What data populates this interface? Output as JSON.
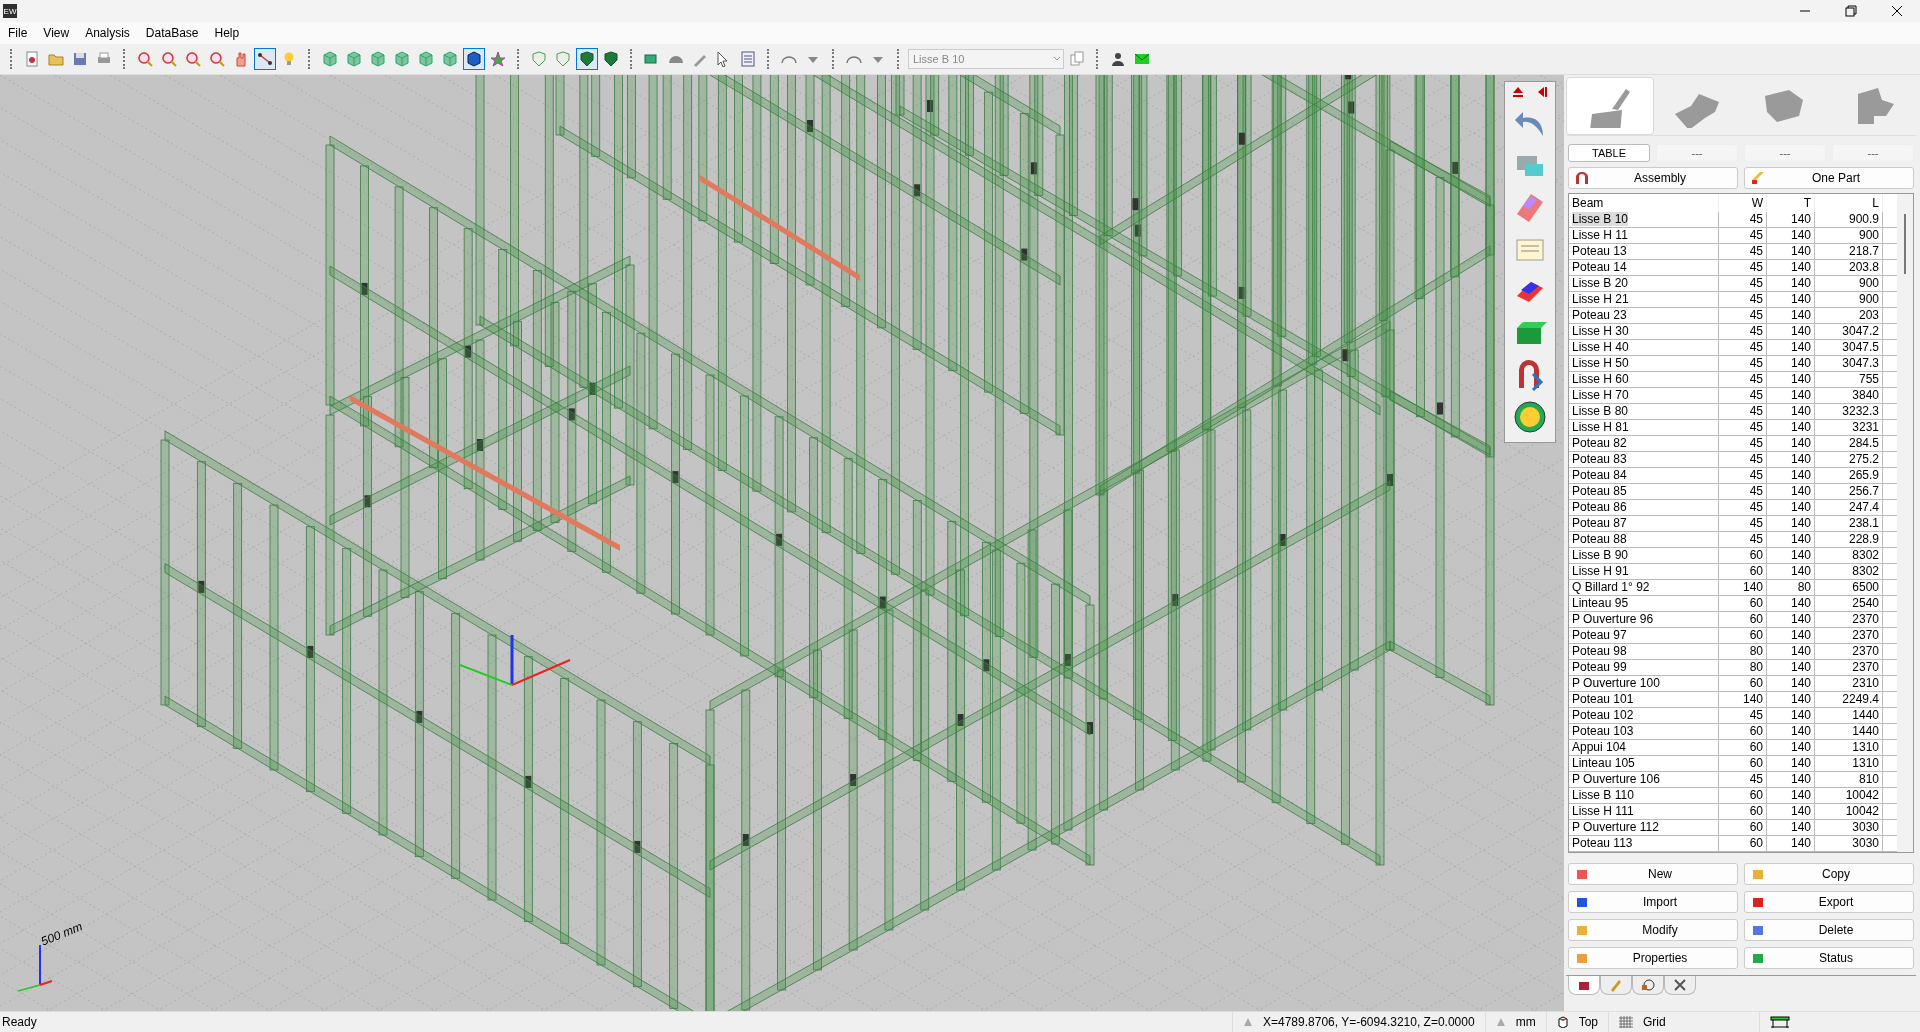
{
  "window": {
    "app_icon_text": "EW"
  },
  "menu": [
    "File",
    "View",
    "Analysis",
    "DataBase",
    "Help"
  ],
  "toolbar": {
    "groups": [
      {
        "buttons": [
          {
            "selected": false
          },
          {
            "selected": false
          },
          {
            "selected": false
          },
          {
            "selected": false
          }
        ]
      },
      {
        "buttons": [
          {
            "selected": false
          },
          {
            "selected": false
          },
          {
            "selected": false
          },
          {
            "selected": false
          },
          {
            "selected": false
          },
          {
            "selected": true
          },
          {
            "selected": false
          }
        ]
      },
      {
        "buttons": [
          {
            "selected": false
          },
          {
            "selected": false
          },
          {
            "selected": false
          },
          {
            "selected": false
          },
          {
            "selected": false
          },
          {
            "selected": false
          },
          {
            "selected": true
          },
          {
            "selected": false
          }
        ]
      },
      {
        "buttons": [
          {
            "selected": false
          },
          {
            "selected": false
          },
          {
            "selected": true
          },
          {
            "selected": false
          }
        ]
      },
      {
        "buttons": [
          {
            "selected": false
          },
          {
            "selected": false
          },
          {
            "selected": false
          },
          {
            "selected": false
          },
          {
            "selected": false
          }
        ]
      },
      {
        "buttons": [
          {
            "selected": false
          },
          {
            "selected": false
          }
        ]
      },
      {
        "buttons": [
          {
            "selected": false
          },
          {
            "selected": false
          }
        ]
      }
    ],
    "combo": {
      "value": "Lisse B 10",
      "disabled": true
    }
  },
  "viewport": {
    "scale_label": "500 mm"
  },
  "panel": {
    "icon_tabs": [
      {
        "selected": true
      },
      {
        "selected": false
      },
      {
        "selected": false
      },
      {
        "selected": false
      }
    ],
    "sub_tabs": [
      {
        "label": "TABLE",
        "selected": true
      },
      {
        "label": "---",
        "selected": false
      },
      {
        "label": "---",
        "selected": false
      },
      {
        "label": "---",
        "selected": false
      }
    ],
    "mode_buttons": [
      "Assembly",
      "One Part"
    ],
    "table": {
      "columns": [
        "Beam",
        "W",
        "T",
        "L"
      ],
      "rows": [
        {
          "beam": "Lisse B 10",
          "w": "45",
          "t": "140",
          "l": "900.9",
          "selected": true
        },
        {
          "beam": "Lisse H 11",
          "w": "45",
          "t": "140",
          "l": "900",
          "selected": false
        },
        {
          "beam": "Poteau 13",
          "w": "45",
          "t": "140",
          "l": "218.7",
          "selected": false
        },
        {
          "beam": "Poteau 14",
          "w": "45",
          "t": "140",
          "l": "203.8",
          "selected": false
        },
        {
          "beam": "Lisse B 20",
          "w": "45",
          "t": "140",
          "l": "900",
          "selected": false
        },
        {
          "beam": "Lisse H 21",
          "w": "45",
          "t": "140",
          "l": "900",
          "selected": false
        },
        {
          "beam": "Poteau 23",
          "w": "45",
          "t": "140",
          "l": "203",
          "selected": false
        },
        {
          "beam": "Lisse H 30",
          "w": "45",
          "t": "140",
          "l": "3047.2",
          "selected": false
        },
        {
          "beam": "Lisse H 40",
          "w": "45",
          "t": "140",
          "l": "3047.5",
          "selected": false
        },
        {
          "beam": "Lisse H 50",
          "w": "45",
          "t": "140",
          "l": "3047.3",
          "selected": false
        },
        {
          "beam": "Lisse H 60",
          "w": "45",
          "t": "140",
          "l": "755",
          "selected": false
        },
        {
          "beam": "Lisse H 70",
          "w": "45",
          "t": "140",
          "l": "3840",
          "selected": false
        },
        {
          "beam": "Lisse B 80",
          "w": "45",
          "t": "140",
          "l": "3232.3",
          "selected": false
        },
        {
          "beam": "Lisse H 81",
          "w": "45",
          "t": "140",
          "l": "3231",
          "selected": false
        },
        {
          "beam": "Poteau 82",
          "w": "45",
          "t": "140",
          "l": "284.5",
          "selected": false
        },
        {
          "beam": "Poteau 83",
          "w": "45",
          "t": "140",
          "l": "275.2",
          "selected": false
        },
        {
          "beam": "Poteau 84",
          "w": "45",
          "t": "140",
          "l": "265.9",
          "selected": false
        },
        {
          "beam": "Poteau 85",
          "w": "45",
          "t": "140",
          "l": "256.7",
          "selected": false
        },
        {
          "beam": "Poteau 86",
          "w": "45",
          "t": "140",
          "l": "247.4",
          "selected": false
        },
        {
          "beam": "Poteau 87",
          "w": "45",
          "t": "140",
          "l": "238.1",
          "selected": false
        },
        {
          "beam": "Poteau 88",
          "w": "45",
          "t": "140",
          "l": "228.9",
          "selected": false
        },
        {
          "beam": "Lisse B 90",
          "w": "60",
          "t": "140",
          "l": "8302",
          "selected": false
        },
        {
          "beam": "Lisse H 91",
          "w": "60",
          "t": "140",
          "l": "8302",
          "selected": false
        },
        {
          "beam": "Q Billard 1° 92",
          "w": "140",
          "t": "80",
          "l": "6500",
          "selected": false
        },
        {
          "beam": "Linteau 95",
          "w": "60",
          "t": "140",
          "l": "2540",
          "selected": false
        },
        {
          "beam": "P Ouverture 96",
          "w": "60",
          "t": "140",
          "l": "2370",
          "selected": false
        },
        {
          "beam": "Poteau 97",
          "w": "60",
          "t": "140",
          "l": "2370",
          "selected": false
        },
        {
          "beam": "Poteau 98",
          "w": "80",
          "t": "140",
          "l": "2370",
          "selected": false
        },
        {
          "beam": "Poteau 99",
          "w": "80",
          "t": "140",
          "l": "2370",
          "selected": false
        },
        {
          "beam": "P Ouverture 100",
          "w": "60",
          "t": "140",
          "l": "2310",
          "selected": false
        },
        {
          "beam": "Poteau 101",
          "w": "140",
          "t": "140",
          "l": "2249.4",
          "selected": false
        },
        {
          "beam": "Poteau 102",
          "w": "45",
          "t": "140",
          "l": "1440",
          "selected": false
        },
        {
          "beam": "Poteau 103",
          "w": "60",
          "t": "140",
          "l": "1440",
          "selected": false
        },
        {
          "beam": "Appui 104",
          "w": "60",
          "t": "140",
          "l": "1310",
          "selected": false
        },
        {
          "beam": "Linteau 105",
          "w": "60",
          "t": "140",
          "l": "1310",
          "selected": false
        },
        {
          "beam": "P Ouverture 106",
          "w": "45",
          "t": "140",
          "l": "810",
          "selected": false
        },
        {
          "beam": "Lisse B 110",
          "w": "60",
          "t": "140",
          "l": "10042",
          "selected": false
        },
        {
          "beam": "Lisse H 111",
          "w": "60",
          "t": "140",
          "l": "10042",
          "selected": false
        },
        {
          "beam": "P Ouverture 112",
          "w": "60",
          "t": "140",
          "l": "3030",
          "selected": false
        },
        {
          "beam": "Poteau 113",
          "w": "60",
          "t": "140",
          "l": "3030",
          "selected": false
        }
      ]
    },
    "action_buttons": [
      "New",
      "Copy",
      "Import",
      "Export",
      "Modify",
      "Delete",
      "Properties",
      "Status"
    ],
    "bottom_tabs": [
      {
        "selected": true
      },
      {
        "selected": false
      },
      {
        "selected": false
      },
      {
        "selected": false
      }
    ]
  },
  "status_bar": {
    "message": "Ready",
    "coordinates": "X=4789.8706, Y=-6094.3210, Z=0.0000",
    "units": "mm",
    "view": "Top",
    "grid": "Grid"
  }
}
